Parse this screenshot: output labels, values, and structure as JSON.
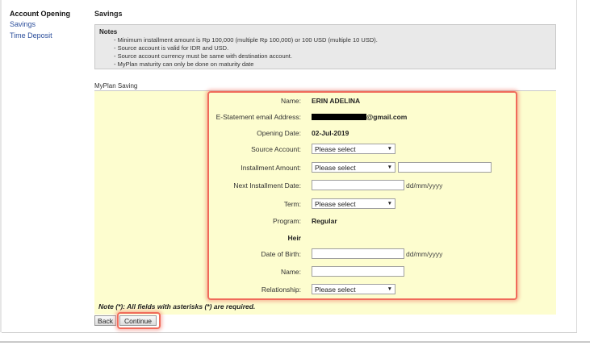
{
  "sidebar": {
    "heading": "Account Opening",
    "items": [
      {
        "label": "Savings"
      },
      {
        "label": "Time Deposit"
      }
    ]
  },
  "section_title": "Savings",
  "notes": {
    "title": "Notes",
    "items": [
      "Minimum installment amount is Rp 100,000 (multiple Rp 100,000) or 100 USD (multiple 10 USD).",
      "Source account is valid for IDR and USD.",
      "Source account currency must be same with destination account.",
      "MyPlan maturity can only be done on maturity date"
    ]
  },
  "form": {
    "subtitle": "MyPlan Saving",
    "name": {
      "label": "Name:",
      "value": "ERIN ADELINA"
    },
    "email": {
      "label": "E-Statement email Address:",
      "value_suffix": "@gmail.com"
    },
    "opening_date": {
      "label": "Opening Date:",
      "value": "02-Jul-2019"
    },
    "source_account": {
      "label": "Source Account:",
      "selected": "Please select"
    },
    "installment_amount": {
      "label": "Installment Amount:",
      "selected": "Please select",
      "amount_value": ""
    },
    "next_installment_date": {
      "label": "Next Installment Date:",
      "value": "",
      "hint": "dd/mm/yyyy"
    },
    "term": {
      "label": "Term:",
      "selected": "Please select"
    },
    "program": {
      "label": "Program:",
      "value": "Regular"
    },
    "heir": {
      "heading": "Heir",
      "dob": {
        "label": "Date of Birth:",
        "value": "",
        "hint": "dd/mm/yyyy"
      },
      "name": {
        "label": "Name:",
        "value": ""
      },
      "relationship": {
        "label": "Relationship:",
        "selected": "Please select"
      }
    },
    "footnote": "Note (*): All fields with asterisks (*) are required."
  },
  "buttons": {
    "back": "Back",
    "continue": "Continue"
  },
  "icons": {
    "dropdown": "chevron-down-icon"
  },
  "colors": {
    "link": "#2b4e9b",
    "form_background": "#fdfdcf",
    "notes_background": "#e9e9e9",
    "highlight": "#f06b5b"
  }
}
